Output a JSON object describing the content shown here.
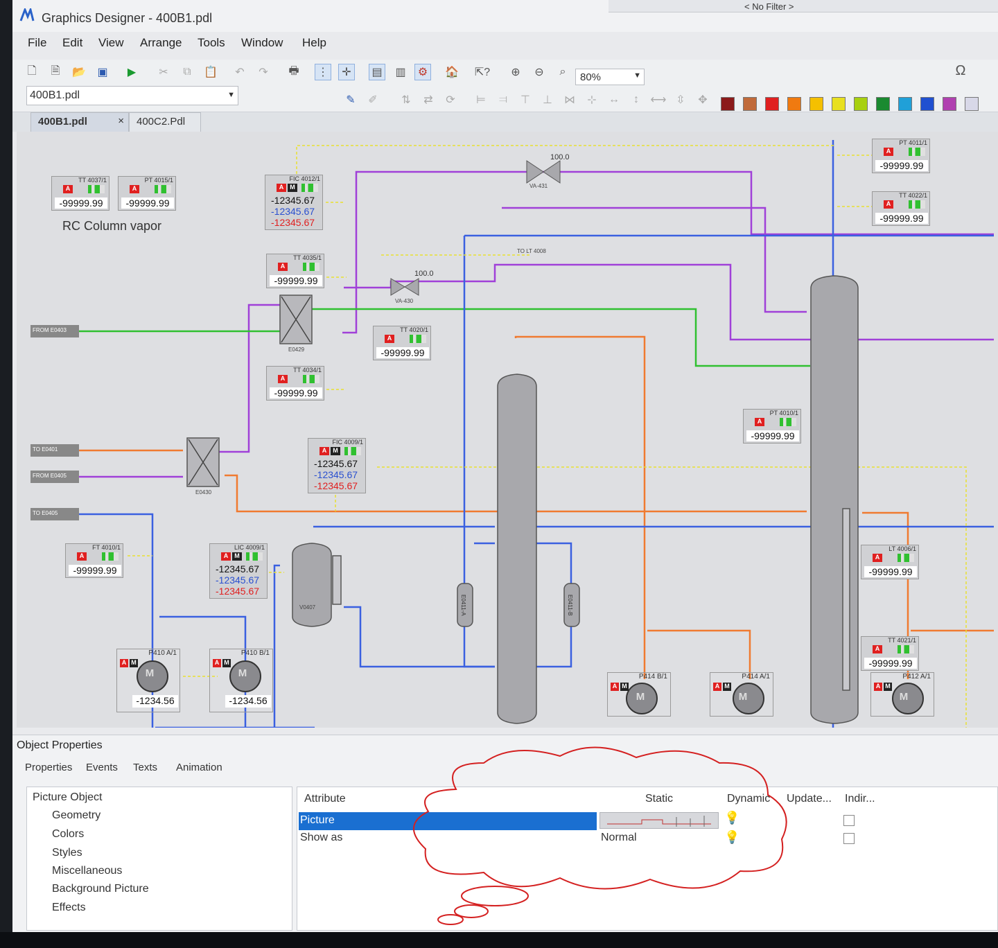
{
  "window": {
    "title": "Graphics Designer - 400B1.pdl",
    "filter_text": "< No Filter >"
  },
  "menu": [
    "File",
    "Edit",
    "View",
    "Arrange",
    "Tools",
    "Window",
    "Help"
  ],
  "toolbar": {
    "zoom": "80%",
    "file_select": "400B1.pdl",
    "colors": [
      "#8b1a1a",
      "#c06a3a",
      "#e02020",
      "#f07a10",
      "#f5c000",
      "#e8e020",
      "#a8d010",
      "#1a8a30",
      "#20a0d8",
      "#2050d0",
      "#b040b0",
      "#d8d8e8"
    ]
  },
  "tabs": [
    {
      "label": "400B1.pdl",
      "close": "×"
    },
    {
      "label": "400C2.Pdl"
    }
  ],
  "canvas": {
    "area_label": "RC Column vapor",
    "value_default": "-99999.99",
    "value_ctrl_1": "-12345.67",
    "value_ctrl_2": "-12345.67",
    "value_ctrl_3": "-12345.67",
    "motor_value": "-1234.56",
    "valve_value": "100.0",
    "tags": {
      "tt4037": "TT 4037/1",
      "pt4015": "PT 4015/1",
      "fic4012": "FIC 4012/1",
      "tt4035": "TT 4035/1",
      "tt4034": "TT 4034/1",
      "tt4020": "TT 4020/1",
      "pt4011": "PT 4011/1",
      "tt4022": "TT 4022/1",
      "pt4010": "PT 4010/1",
      "fic4009": "FIC 4009/1",
      "ft4010": "FT 4010/1",
      "lic4009": "LIC 4009/1",
      "lt4006": "LT 4006/1",
      "tt4021": "TT 4021/1",
      "p410a": "P410 A/1",
      "p410b": "P410 B/1",
      "p414b": "P414 B/1",
      "p414a": "P414 A/1",
      "p412a": "P412 A/1"
    },
    "flags": {
      "alarm": "A",
      "manual": "M"
    },
    "labels": {
      "from_e1": "FROM E0403",
      "to_e1": "TO E0401",
      "from_e2": "FROM E0405",
      "to_e2": "TO E0405",
      "to_lt": "TO LT 4008",
      "va431": "VA-431",
      "va430": "VA-430",
      "e0429": "E0429",
      "e0430": "E0430",
      "v0407": "V0407",
      "e0411a": "E0411-A",
      "e0411b": "E0411-B"
    }
  },
  "properties": {
    "title": "Object Properties",
    "tabs": [
      "Properties",
      "Events",
      "Texts",
      "Animation"
    ],
    "tree": [
      "Picture Object",
      "Geometry",
      "Colors",
      "Styles",
      "Miscellaneous",
      "Background Picture",
      "Effects"
    ],
    "columns": {
      "attribute": "Attribute",
      "static": "Static",
      "dynamic": "Dynamic",
      "update": "Update...",
      "indirect": "Indir..."
    },
    "rows": [
      {
        "attribute": "Picture",
        "static": ""
      },
      {
        "attribute": "Show as",
        "static": "Normal"
      }
    ]
  }
}
